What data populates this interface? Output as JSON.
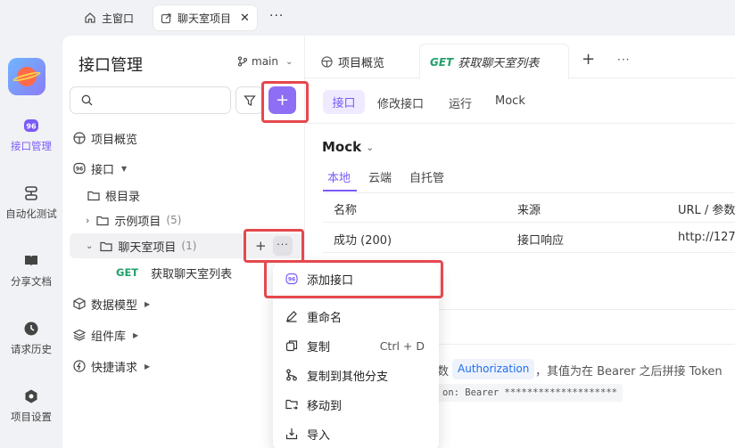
{
  "topbar": {
    "tabs": [
      {
        "label": "主窗口",
        "icon": "home-icon"
      },
      {
        "label": "聊天室项目",
        "icon": "external-link-icon"
      }
    ],
    "more_label": "···"
  },
  "rail": {
    "items": [
      {
        "label": "接口管理",
        "icon": "api-icon",
        "active": true
      },
      {
        "label": "自动化测试",
        "icon": "server-icon"
      },
      {
        "label": "分享文档",
        "icon": "book-icon"
      },
      {
        "label": "请求历史",
        "icon": "clock-icon"
      },
      {
        "label": "项目设置",
        "icon": "hexagon-icon"
      }
    ]
  },
  "sidebar": {
    "title": "接口管理",
    "branch": "main",
    "search_placeholder": "",
    "add_label": "+",
    "tree": {
      "overview": "项目概览",
      "api": "接口",
      "root": "根目录",
      "sample_folder": "示例项目",
      "sample_count": "(5)",
      "chat_folder": "聊天室项目",
      "chat_count": "(1)",
      "endpoint_method": "GET",
      "endpoint_name": "获取聊天室列表",
      "models": "数据模型",
      "components": "组件库",
      "quick": "快捷请求"
    },
    "row_add": "+",
    "row_more": "···"
  },
  "main": {
    "tabs": {
      "overview": "项目概览",
      "endpoint_method": "GET",
      "endpoint_name": "获取聊天室列表",
      "add": "+",
      "more": "···"
    },
    "subtabs": [
      "接口",
      "修改接口",
      "运行",
      "Mock"
    ],
    "mock_title": "Mock",
    "mock_tabs": [
      "本地",
      "云端",
      "自托管"
    ],
    "table": {
      "headers": [
        "名称",
        "来源",
        "URL / 参数"
      ],
      "row": [
        "成功 (200)",
        "接口响应",
        "http://127."
      ]
    },
    "bottom": {
      "prefix": "数",
      "badge": "Authorization",
      "text": "，其值为在 Bearer 之后拼接 Token",
      "code": "on: Bearer ********************"
    }
  },
  "menu": {
    "items": [
      {
        "label": "添加接口",
        "icon": "api-icon",
        "shortcut": ""
      },
      {
        "label": "重命名",
        "icon": "pencil-icon",
        "shortcut": ""
      },
      {
        "label": "复制",
        "icon": "copy-icon",
        "shortcut": "Ctrl + D"
      },
      {
        "label": "复制到其他分支",
        "icon": "branch-icon",
        "shortcut": ""
      },
      {
        "label": "移动到",
        "icon": "folder-move-icon",
        "shortcut": ""
      },
      {
        "label": "导入",
        "icon": "import-icon",
        "shortcut": ""
      }
    ]
  },
  "colors": {
    "accent": "#7a5af8",
    "highlight": "#e5484d",
    "get": "#22a06b"
  }
}
